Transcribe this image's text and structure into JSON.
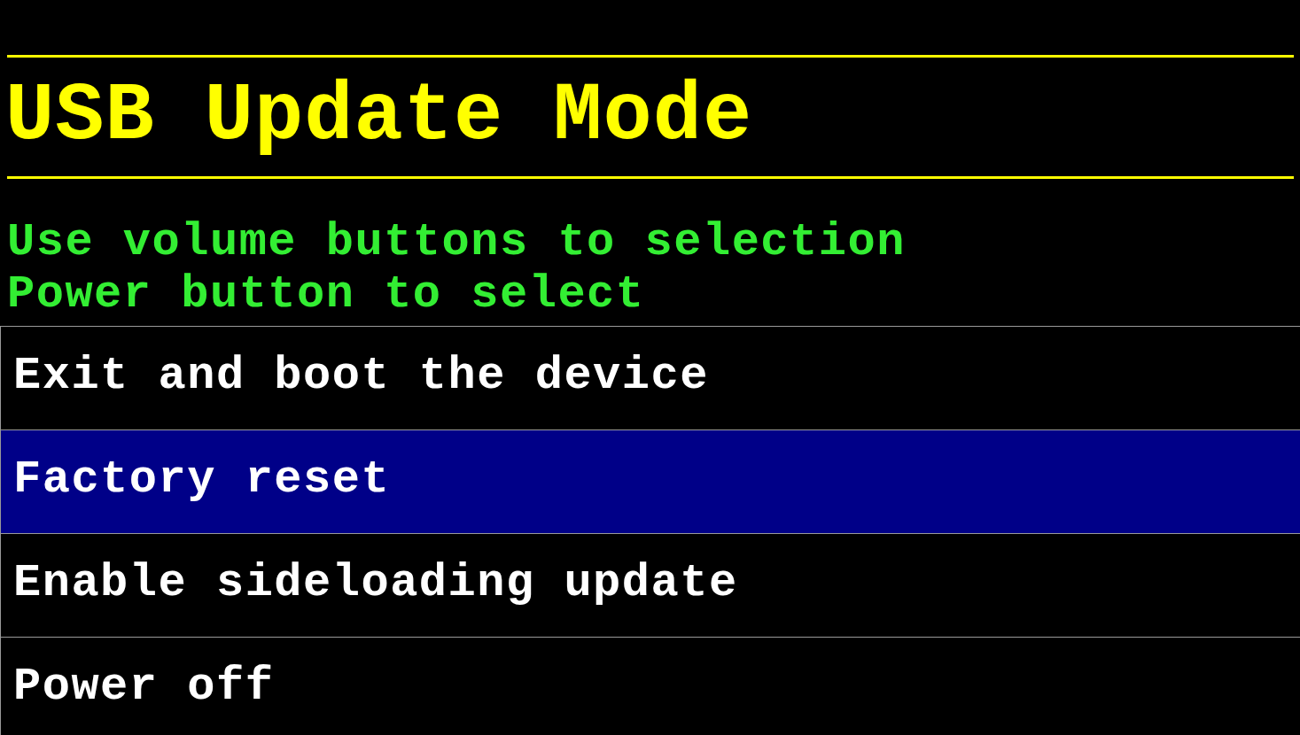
{
  "title": "USB Update Mode",
  "instructions": [
    "Use volume buttons to selection",
    "Power button to select"
  ],
  "menu": [
    {
      "label": "Exit and boot the device",
      "selected": false
    },
    {
      "label": "Factory reset",
      "selected": true
    },
    {
      "label": "Enable sideloading update",
      "selected": false
    },
    {
      "label": "Power off",
      "selected": false
    }
  ]
}
